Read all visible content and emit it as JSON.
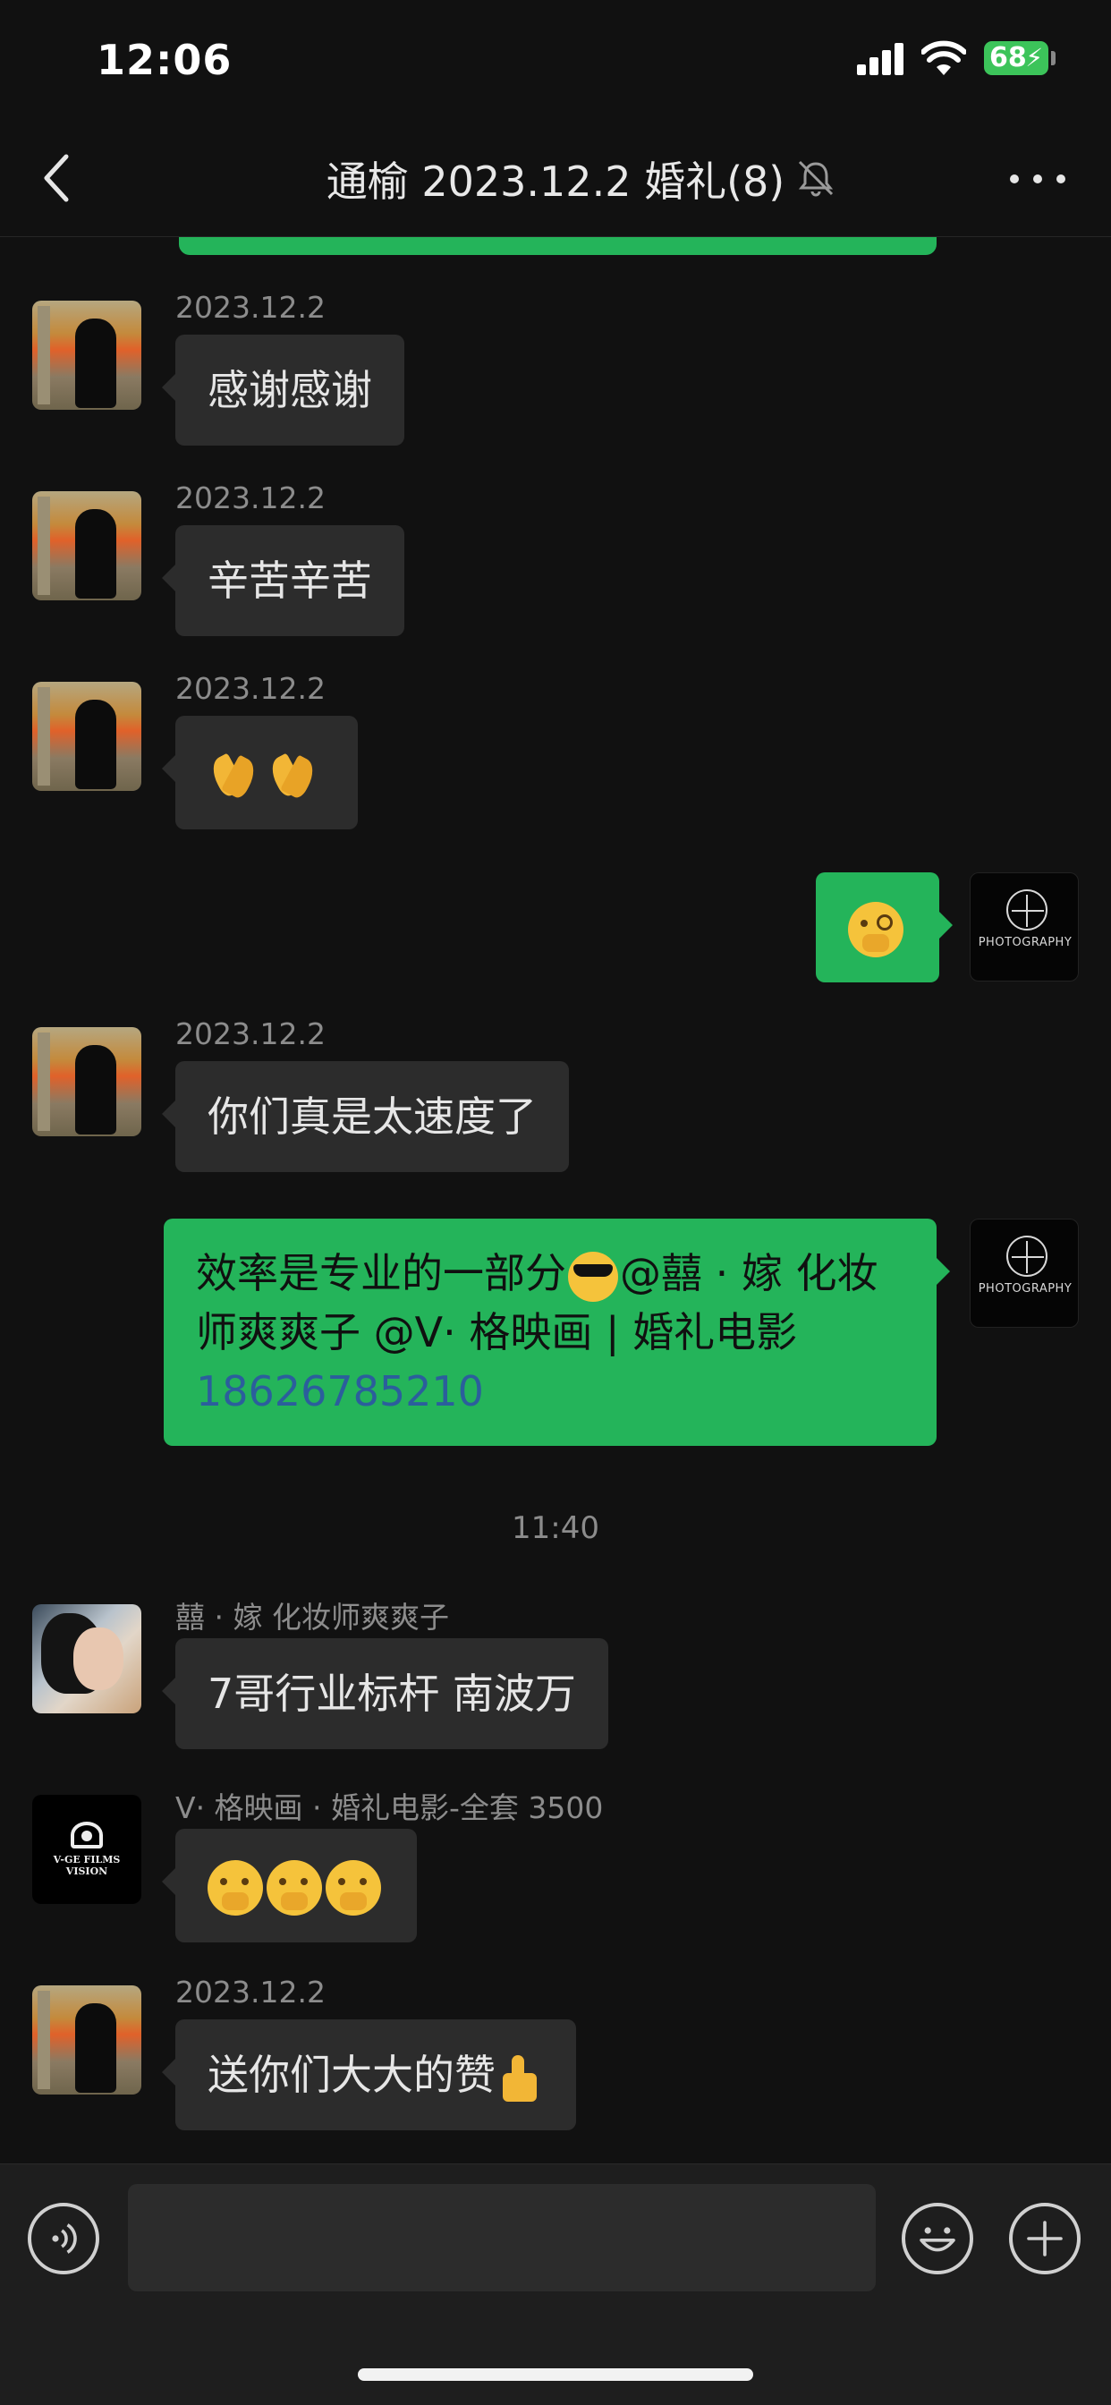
{
  "status_bar": {
    "time": "12:06",
    "battery": "68"
  },
  "header": {
    "title": "通榆 2023.12.2 婚礼(8)"
  },
  "messages": [
    {
      "sender": "2023.12.2",
      "text": "感谢感谢"
    },
    {
      "sender": "2023.12.2",
      "text": "辛苦辛苦"
    },
    {
      "sender": "2023.12.2",
      "emoji": "folded-hands x2"
    },
    {
      "self": true,
      "emoji": "monocle-face"
    },
    {
      "sender": "2023.12.2",
      "text": "你们真是太速度了"
    },
    {
      "self": true,
      "text_part1": "效率是专业的一部分",
      "emoji": "sunglasses-face",
      "text_part2": "@囍 · 嫁 化妆师爽爽子 @V· 格映画 | 婚礼电影",
      "phone": "18626785210"
    },
    {
      "sender": "囍 · 嫁 化妆师爽爽子",
      "text": "7哥行业标杆 南波万"
    },
    {
      "sender": "V· 格映画 · 婚礼电影-全套 3500",
      "emoji": "shushing-face x3"
    },
    {
      "sender": "2023.12.2",
      "text": "送你们大大的赞",
      "emoji": "thumbs-up"
    }
  ],
  "time_separator": "11:40",
  "avatars": {
    "studio_text": "PHOTOGRAPHY",
    "films_text": "V-GE FILMS VISION"
  },
  "input": {
    "value": "",
    "placeholder": ""
  },
  "colors": {
    "outgoing_bubble": "#24b45a",
    "incoming_bubble": "#2c2c2c",
    "background": "#111111",
    "link": "#2b5e9c"
  }
}
